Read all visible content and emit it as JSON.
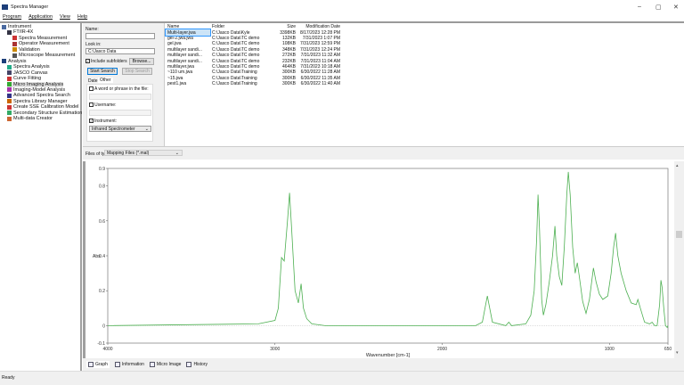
{
  "window": {
    "title": "Spectra Manager",
    "controls": [
      "–",
      "▢",
      "✕"
    ]
  },
  "menu": [
    "Program",
    "Application",
    "View",
    "Help"
  ],
  "tree": [
    {
      "label": "Instrument",
      "level": 0,
      "color": "#4a6aa0"
    },
    {
      "label": "FT/IR-4X",
      "level": 1,
      "color": "#334"
    },
    {
      "label": "Spectra Measurement",
      "level": 2,
      "color": "#c33"
    },
    {
      "label": "Operator Measurement",
      "level": 2,
      "color": "#a33"
    },
    {
      "label": "Validation",
      "level": 2,
      "color": "#c80"
    },
    {
      "label": "Microscope Measurement",
      "level": 2,
      "color": "#555"
    },
    {
      "label": "Analysis",
      "level": 0,
      "color": "#1d3f7a"
    },
    {
      "label": "Spectra Analysis",
      "level": 1,
      "color": "#2a8"
    },
    {
      "label": "JASCO Canvas",
      "level": 1,
      "color": "#446"
    },
    {
      "label": "Curve Fitting",
      "level": 1,
      "color": "#c33"
    },
    {
      "label": "Micro Imaging Analysis",
      "level": 1,
      "color": "#3a3",
      "selected": true
    },
    {
      "label": "Imaging-Model Analysis",
      "level": 1,
      "color": "#a3a"
    },
    {
      "label": "Advanced Spectra Search",
      "level": 1,
      "color": "#338"
    },
    {
      "label": "Spectra Library Manager",
      "level": 1,
      "color": "#c60"
    },
    {
      "label": "Create SSE Calibration Model",
      "level": 1,
      "color": "#c33"
    },
    {
      "label": "Secondary Structure Estimation",
      "level": 1,
      "color": "#3a6"
    },
    {
      "label": "Multi-data Creator",
      "level": 1,
      "color": "#c63"
    }
  ],
  "search": {
    "name_label": "Name:",
    "name_value": "",
    "lookin_label": "Look in:",
    "lookin_value": "C:\\Jasco Data",
    "include_subfolders": "Include subfolders",
    "browse": "Browse...",
    "start": "Start Search",
    "stop": "Stop Search",
    "tab_date": "Date",
    "tab_other": "Other",
    "word_phrase": "A word or phrase in the file:",
    "username": "Username:",
    "instrument": "Instrument:",
    "instrument_value": "Infrared Spectrometer"
  },
  "files": {
    "columns": [
      "Name",
      "Folder",
      "Size",
      "Modification Date"
    ],
    "rows": [
      [
        "Multi-layer.jwa",
        "C:\\Jasco Data\\Kyle",
        "3398KB",
        "8/17/2023 12:28 PM"
      ],
      [
        "gel-2.jwa.jwa",
        "C:\\Jasco Data\\TC demo",
        "132KB",
        "7/31/2023 1:07 PM"
      ],
      [
        "gel.jwa",
        "C:\\Jasco Data\\TC demo",
        "108KB",
        "7/31/2023 12:59 PM"
      ],
      [
        "multilayer sandi...",
        "C:\\Jasco Data\\TC demo",
        "348KB",
        "7/31/2023 12:24 PM"
      ],
      [
        "multilayer sandi...",
        "C:\\Jasco Data\\TC demo",
        "272KB",
        "7/31/2023 11:32 AM"
      ],
      [
        "multilayer sandi...",
        "C:\\Jasco Data\\TC demo",
        "232KB",
        "7/31/2023 11:04 AM"
      ],
      [
        "multilayer.jwa",
        "C:\\Jasco Data\\TC demo",
        "464KB",
        "7/31/2023 10:18 AM"
      ],
      [
        "~110 um.jwa",
        "C:\\Jasco Data\\Training",
        "300KB",
        "6/30/2022 11:28 AM"
      ],
      [
        "~15.jwa",
        "C:\\Jasco Data\\Training",
        "300KB",
        "6/30/2022 11:35 AM"
      ],
      [
        "pest1.jwa",
        "C:\\Jasco Data\\Training",
        "300KB",
        "6/30/2022 11:40 AM"
      ]
    ]
  },
  "filter": {
    "label": "Files of type:",
    "value": "Mapping Files (*.mal)"
  },
  "tabs": [
    "Graph",
    "Information",
    "Micro Image",
    "History"
  ],
  "status": "Ready",
  "chart_data": {
    "type": "line",
    "title": "",
    "xlabel": "Wavenumber [cm-1]",
    "ylabel": "Abs",
    "xlim": [
      4000,
      650
    ],
    "ylim": [
      -0.1,
      0.9
    ],
    "xticks": [
      4000,
      3000,
      2000,
      1000,
      650
    ],
    "yticks": [
      0.9,
      0.8,
      0.6,
      0.4,
      0.2,
      0,
      -0.1
    ],
    "color": "#4caf50",
    "x": [
      4000,
      3100,
      3000,
      2980,
      2961,
      2945,
      2925,
      2913,
      2900,
      2880,
      2860,
      2844,
      2830,
      2810,
      2780,
      2700,
      1800,
      1760,
      1740,
      1730,
      1720,
      1700,
      1620,
      1602,
      1585,
      1500,
      1470,
      1450,
      1435,
      1427,
      1418,
      1405,
      1395,
      1380,
      1360,
      1340,
      1326,
      1315,
      1300,
      1285,
      1270,
      1255,
      1246,
      1235,
      1220,
      1205,
      1192,
      1180,
      1160,
      1140,
      1120,
      1096,
      1080,
      1060,
      1040,
      1010,
      990,
      975,
      963,
      950,
      930,
      900,
      870,
      840,
      830,
      815,
      790,
      760,
      745,
      730,
      715,
      700,
      692,
      685,
      675,
      665,
      655,
      650
    ],
    "y": [
      0,
      0.01,
      0.03,
      0.1,
      0.39,
      0.37,
      0.6,
      0.76,
      0.55,
      0.2,
      0.13,
      0.24,
      0.1,
      0.04,
      0.01,
      0,
      0,
      0.02,
      0.12,
      0.17,
      0.12,
      0.02,
      0,
      0.02,
      0,
      0.01,
      0.06,
      0.2,
      0.5,
      0.75,
      0.55,
      0.15,
      0.06,
      0.12,
      0.25,
      0.4,
      0.57,
      0.4,
      0.28,
      0.23,
      0.45,
      0.75,
      0.88,
      0.75,
      0.45,
      0.3,
      0.36,
      0.28,
      0.14,
      0.07,
      0.15,
      0.33,
      0.25,
      0.18,
      0.15,
      0.17,
      0.3,
      0.45,
      0.53,
      0.4,
      0.3,
      0.2,
      0.13,
      0.12,
      0.15,
      0.1,
      0.02,
      0.01,
      0.02,
      0,
      0,
      0.12,
      0.26,
      0.22,
      0.1,
      0,
      -0.01,
      0
    ]
  }
}
